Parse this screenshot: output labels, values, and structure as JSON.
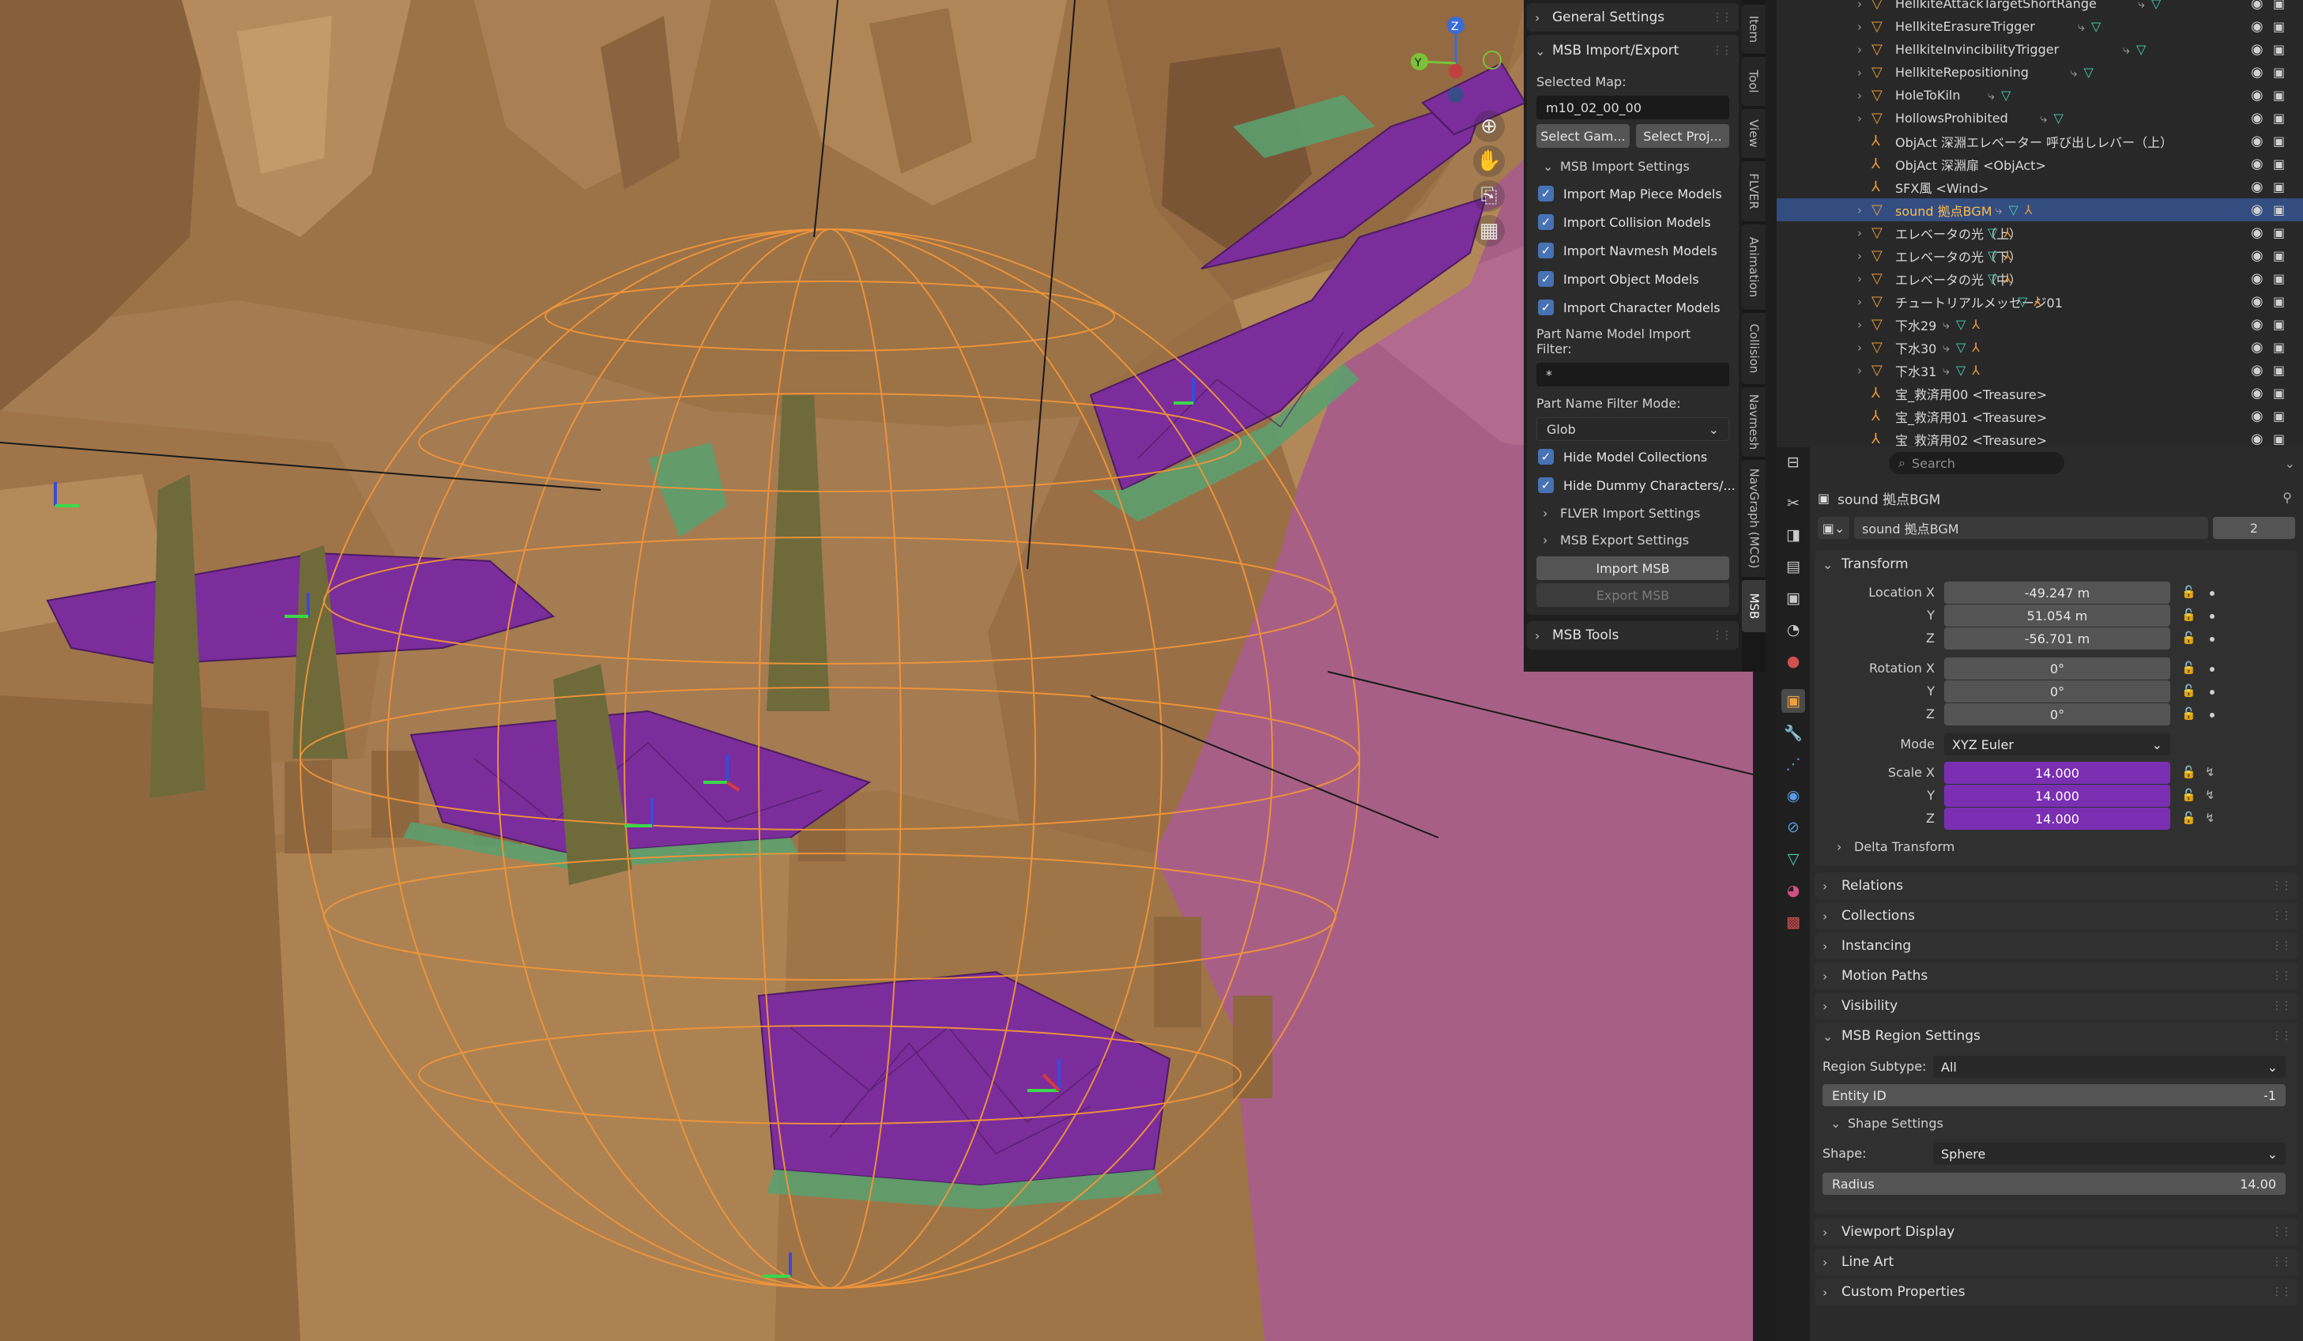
{
  "viewport": {
    "gizmo": {
      "z": "Z",
      "y": "Y"
    },
    "nav_icons": [
      "zoom-icon",
      "hand-icon",
      "camera-icon",
      "grid-icon"
    ]
  },
  "npanel": {
    "general_settings": "General Settings",
    "msb_import_export": "MSB Import/Export",
    "selected_map_label": "Selected Map:",
    "selected_map_value": "m10_02_00_00",
    "select_game_btn": "Select Gam...",
    "select_project_btn": "Select Proj...",
    "import_settings": "MSB Import Settings",
    "checkboxes": [
      {
        "label": "Import Map Piece Models",
        "checked": true
      },
      {
        "label": "Import Collision Models",
        "checked": true
      },
      {
        "label": "Import Navmesh Models",
        "checked": true
      },
      {
        "label": "Import Object Models",
        "checked": true
      },
      {
        "label": "Import Character Models",
        "checked": true
      }
    ],
    "filter_label": "Part Name Model Import Filter:",
    "filter_value": "*",
    "filter_mode_label": "Part Name Filter Mode:",
    "filter_mode_value": "Glob",
    "hide_model_collections": "Hide Model Collections",
    "hide_dummy": "Hide Dummy Characters/...",
    "flver_import": "FLVER Import Settings",
    "msb_export": "MSB Export Settings",
    "import_msb": "Import MSB",
    "export_msb": "Export MSB",
    "msb_tools": "MSB Tools"
  },
  "vtabs": [
    "Item",
    "Tool",
    "View",
    "FLVER",
    "Animation",
    "Collision",
    "Navmesh",
    "NavGraph (MCG)",
    "MSB"
  ],
  "outliner": {
    "rows": [
      {
        "name": "HellkiteAttackTargetShortRange",
        "type": "tri",
        "chev": true,
        "extras": "mod"
      },
      {
        "name": "HellkiteErasureTrigger",
        "type": "tri",
        "chev": true,
        "extras": "mod"
      },
      {
        "name": "HellkiteInvincibilityTrigger",
        "type": "tri",
        "chev": true,
        "extras": "mod"
      },
      {
        "name": "HellkiteRepositioning",
        "type": "tri",
        "chev": true,
        "extras": "mod"
      },
      {
        "name": "HoleToKiln",
        "type": "tri",
        "chev": true,
        "extras": "mod"
      },
      {
        "name": "HollowsProhibited",
        "type": "tri",
        "chev": true,
        "extras": "mod"
      },
      {
        "name": "ObjAct 深淵エレベーター 呼び出しレバー（上）",
        "type": "empty",
        "chev": false,
        "extras": ""
      },
      {
        "name": "ObjAct 深淵扉 <ObjAct>",
        "type": "empty",
        "chev": false,
        "extras": ""
      },
      {
        "name": "SFX風 <Wind>",
        "type": "empty",
        "chev": false,
        "extras": ""
      },
      {
        "name": "sound 拠点BGM",
        "type": "tri",
        "chev": true,
        "extras": "modarm",
        "selected": true
      },
      {
        "name": "エレベータの光（上）",
        "type": "tri",
        "chev": true,
        "extras": "arm"
      },
      {
        "name": "エレベータの光（下）",
        "type": "tri",
        "chev": true,
        "extras": "arm"
      },
      {
        "name": "エレベータの光（中）",
        "type": "tri",
        "chev": true,
        "extras": "arm"
      },
      {
        "name": "チュートリアルメッセージ01",
        "type": "tri",
        "chev": true,
        "extras": "arm"
      },
      {
        "name": "下水29",
        "type": "tri",
        "chev": true,
        "extras": "modarm"
      },
      {
        "name": "下水30",
        "type": "tri",
        "chev": true,
        "extras": "modarm"
      },
      {
        "name": "下水31",
        "type": "tri",
        "chev": true,
        "extras": "modarm"
      },
      {
        "name": "宝_救済用00 <Treasure>",
        "type": "empty",
        "chev": false,
        "extras": ""
      },
      {
        "name": "宝_救済用01 <Treasure>",
        "type": "empty",
        "chev": false,
        "extras": ""
      },
      {
        "name": "宝_救済用02 <Treasure>",
        "type": "empty",
        "chev": false,
        "extras": ""
      }
    ]
  },
  "properties": {
    "search_placeholder": "Search",
    "object_title": "sound 拠点BGM",
    "object_name": "sound 拠点BGM",
    "users": "2",
    "transform": "Transform",
    "location_label": "Location X",
    "loc": {
      "x": "-49.247 m",
      "y": "51.054 m",
      "z": "-56.701 m"
    },
    "rotation_label": "Rotation X",
    "rot": {
      "x": "0°",
      "y": "0°",
      "z": "0°"
    },
    "mode_label": "Mode",
    "mode_value": "XYZ Euler",
    "scale_label": "Scale X",
    "scale": {
      "x": "14.000",
      "y": "14.000",
      "z": "14.000"
    },
    "y": "Y",
    "z": "Z",
    "delta_transform": "Delta Transform",
    "relations": "Relations",
    "collections": "Collections",
    "instancing": "Instancing",
    "motion_paths": "Motion Paths",
    "visibility": "Visibility",
    "msb_region_settings": "MSB Region Settings",
    "region_subtype_label": "Region Subtype:",
    "region_subtype_value": "All",
    "entity_id_label": "Entity ID",
    "entity_id_value": "-1",
    "shape_settings": "Shape Settings",
    "shape_label": "Shape:",
    "shape_value": "Sphere",
    "radius_label": "Radius",
    "radius_value": "14.00",
    "viewport_display": "Viewport Display",
    "line_art": "Line Art",
    "custom_properties": "Custom Properties"
  },
  "colors": {
    "selection": "#334d80",
    "accent_blue": "#4772b3",
    "scale_purple": "#7a2fb3",
    "highlight_name": "#ffbe4a"
  }
}
